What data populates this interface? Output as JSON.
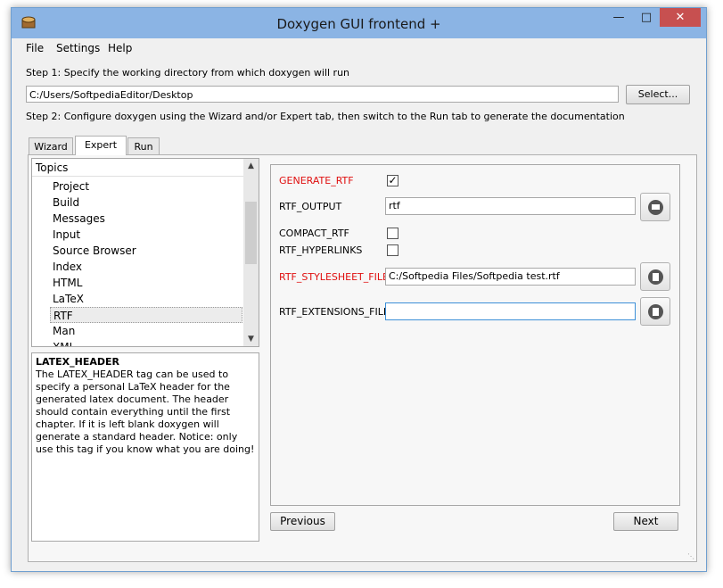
{
  "window": {
    "title": "Doxygen GUI frontend +"
  },
  "menu": {
    "file": "File",
    "settings": "Settings",
    "help": "Help"
  },
  "step1": {
    "label": "Step 1: Specify the working directory from which doxygen will run",
    "path": "C:/Users/SoftpediaEditor/Desktop",
    "select_button": "Select..."
  },
  "step2": {
    "label": "Step 2: Configure doxygen using the Wizard and/or Expert tab, then switch to the Run tab to generate the documentation"
  },
  "tabs": [
    {
      "label": "Wizard"
    },
    {
      "label": "Expert"
    },
    {
      "label": "Run"
    }
  ],
  "topics": {
    "header": "Topics",
    "items": [
      "Project",
      "Build",
      "Messages",
      "Input",
      "Source Browser",
      "Index",
      "HTML",
      "LaTeX",
      "RTF",
      "Man",
      "XML"
    ],
    "selected": "RTF"
  },
  "help": {
    "title": "LATEX_HEADER",
    "body": "The LATEX_HEADER tag can be used to specify a personal LaTeX header for the generated latex document. The header should contain everything until the first chapter. If it is left blank doxygen will generate a standard header. Notice: only use this tag if you know what you are doing!"
  },
  "options": {
    "generate_rtf": {
      "label": "GENERATE_RTF",
      "checked": true
    },
    "rtf_output": {
      "label": "RTF_OUTPUT",
      "value": "rtf"
    },
    "compact_rtf": {
      "label": "COMPACT_RTF",
      "checked": false
    },
    "rtf_hyperlinks": {
      "label": "RTF_HYPERLINKS",
      "checked": false
    },
    "rtf_stylesheet_file": {
      "label": "RTF_STYLESHEET_FILE",
      "value": "C:/Softpedia Files/Softpedia test.rtf"
    },
    "rtf_extensions_file": {
      "label": "RTF_EXTENSIONS_FILE",
      "value": ""
    }
  },
  "nav": {
    "previous": "Previous",
    "next": "Next"
  },
  "colors": {
    "modified_label": "#e01010",
    "titlebar": "#8bb4e4",
    "close_button": "#c75050"
  },
  "icons": {
    "folder_button": "folder-icon",
    "file_button": "file-icon",
    "check": "check-icon"
  }
}
